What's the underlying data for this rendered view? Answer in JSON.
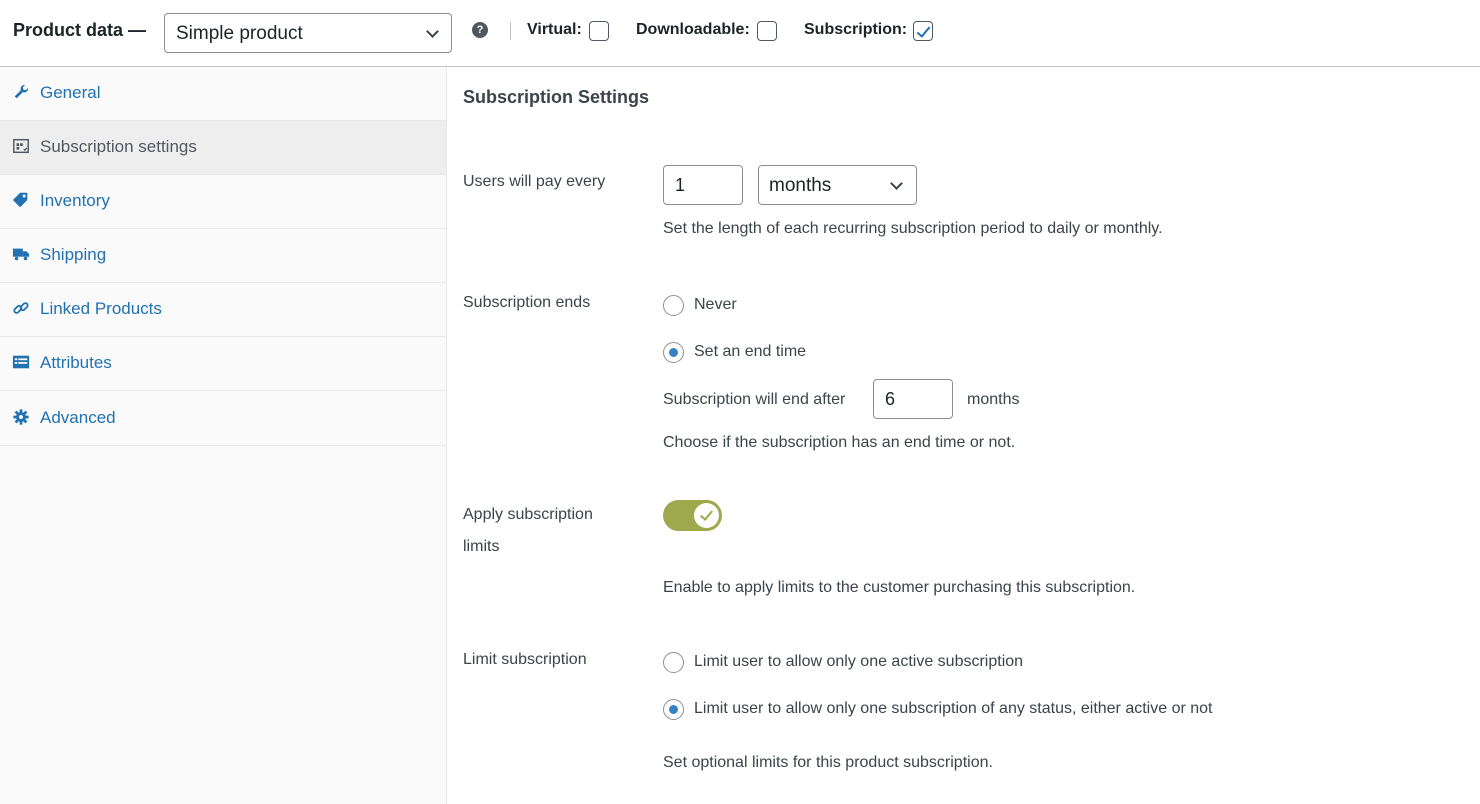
{
  "header": {
    "title": "Product data —",
    "product_type": "Simple product",
    "help_icon": "question-icon",
    "options": [
      {
        "label": "Virtual:",
        "checked": false
      },
      {
        "label": "Downloadable:",
        "checked": false
      },
      {
        "label": "Subscription:",
        "checked": true
      }
    ]
  },
  "sidebar": {
    "items": [
      {
        "label": "General",
        "icon": "wrench-icon",
        "active": false
      },
      {
        "label": "Subscription settings",
        "icon": "calendar-icon",
        "active": true
      },
      {
        "label": "Inventory",
        "icon": "tag-icon",
        "active": false
      },
      {
        "label": "Shipping",
        "icon": "truck-icon",
        "active": false
      },
      {
        "label": "Linked Products",
        "icon": "link-icon",
        "active": false
      },
      {
        "label": "Attributes",
        "icon": "list-icon",
        "active": false
      },
      {
        "label": "Advanced",
        "icon": "gear-icon",
        "active": false
      }
    ]
  },
  "main": {
    "section_title": "Subscription Settings",
    "pay_every": {
      "label": "Users will pay every",
      "interval_value": "1",
      "period_value": "months",
      "description": "Set the length of each recurring subscription period to daily or monthly."
    },
    "ends": {
      "label": "Subscription ends",
      "options": [
        {
          "label": "Never",
          "selected": false
        },
        {
          "label": "Set an end time",
          "selected": true
        }
      ],
      "end_after_label": "Subscription will end after",
      "end_after_value": "6",
      "end_after_unit": "months",
      "description": "Choose if the subscription has an end time or not."
    },
    "limits": {
      "label_line1": "Apply subscription",
      "label_line2": "limits",
      "enabled": true,
      "description": "Enable to apply limits to the customer purchasing this subscription."
    },
    "limit_sub": {
      "label": "Limit subscription",
      "options": [
        {
          "label": "Limit user to allow only one active subscription",
          "selected": false
        },
        {
          "label": "Limit user to allow only one subscription of any status, either active or not",
          "selected": true
        }
      ],
      "description": "Set optional limits for this product subscription."
    }
  },
  "colors": {
    "link": "#2271b1",
    "toggle_on": "#9ea94e",
    "radio_on": "#3582c4"
  }
}
